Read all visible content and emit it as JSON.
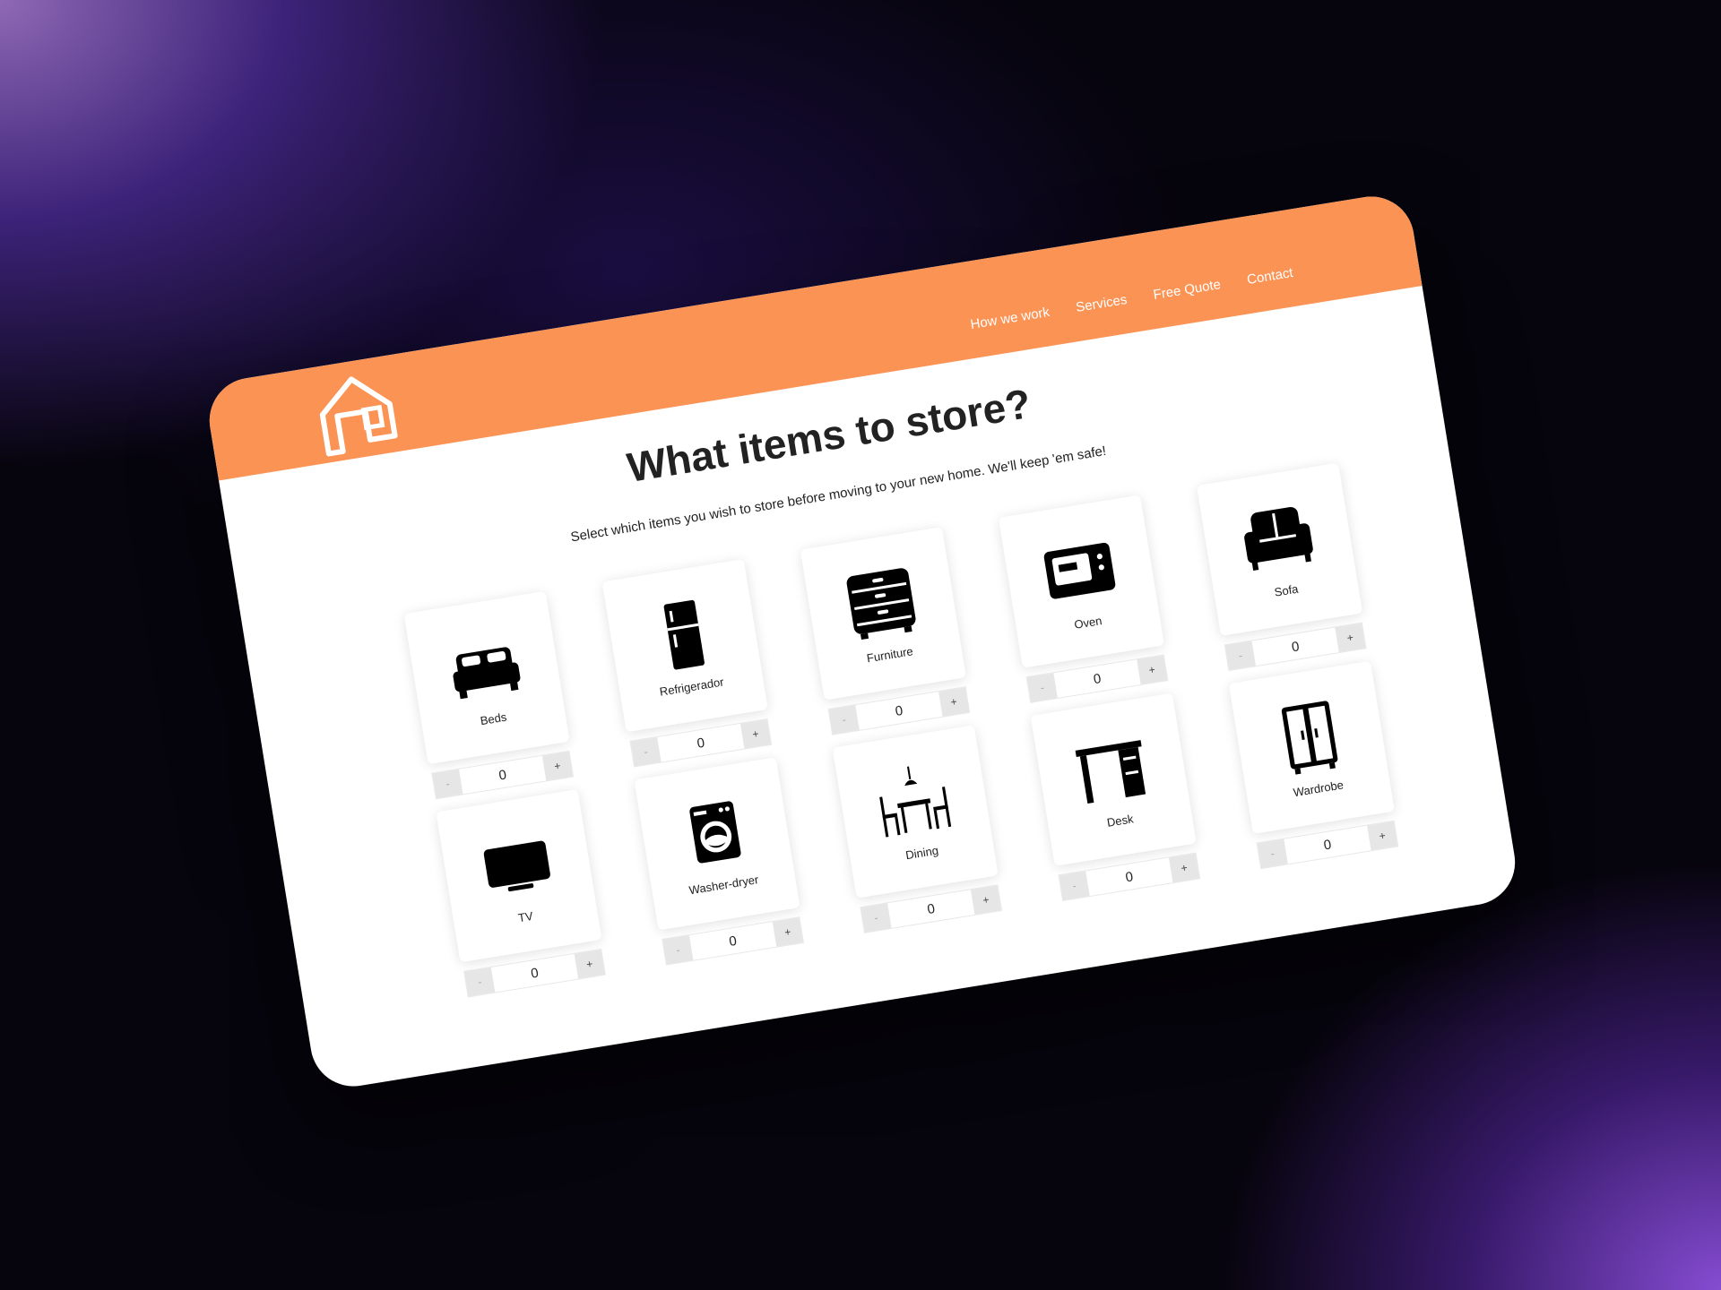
{
  "nav": {
    "items": [
      {
        "label": "How we work"
      },
      {
        "label": "Services"
      },
      {
        "label": "Free Quote"
      },
      {
        "label": "Contact"
      }
    ]
  },
  "hero": {
    "title": "What items to store?",
    "subtitle": "Select which items you wish to store before moving to your new home. We'll keep 'em safe!"
  },
  "colors": {
    "header": "#fb9354",
    "background": "#07040f",
    "card": "#ffffff"
  },
  "stepper": {
    "minus_label": "-",
    "plus_label": "+"
  },
  "items": [
    {
      "label": "Beds",
      "icon": "bed-icon",
      "value": "0"
    },
    {
      "label": "Refrigerador",
      "icon": "refrigerator-icon",
      "value": "0"
    },
    {
      "label": "Furniture",
      "icon": "dresser-icon",
      "value": "0"
    },
    {
      "label": "Oven",
      "icon": "microwave-oven-icon",
      "value": "0"
    },
    {
      "label": "Sofa",
      "icon": "sofa-icon",
      "value": "0"
    },
    {
      "label": "TV",
      "icon": "tv-icon",
      "value": "0"
    },
    {
      "label": "Washer-dryer",
      "icon": "washing-machine-icon",
      "value": "0"
    },
    {
      "label": "Dining",
      "icon": "dining-table-icon",
      "value": "0"
    },
    {
      "label": "Desk",
      "icon": "desk-icon",
      "value": "0"
    },
    {
      "label": "Wardrobe",
      "icon": "wardrobe-icon",
      "value": "0"
    }
  ]
}
